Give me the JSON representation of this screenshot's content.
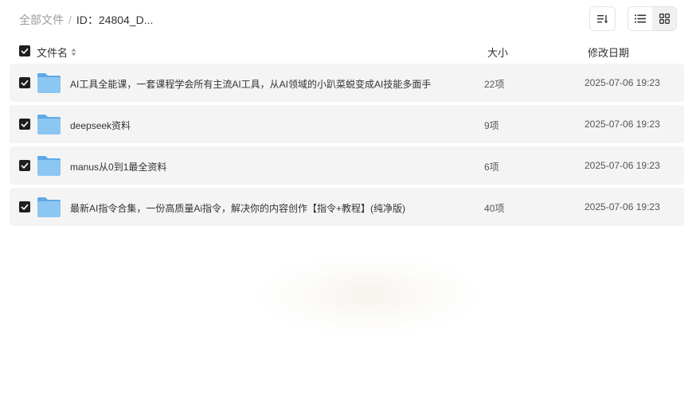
{
  "breadcrumb": {
    "root": "全部文件",
    "separator": "/",
    "current": "ID：24804_D..."
  },
  "toolbar": {
    "sort_icon": "sort-icon",
    "list_icon": "list-view-icon",
    "grid_icon": "grid-view-icon"
  },
  "table": {
    "columns": {
      "name": "文件名",
      "size": "大小",
      "date": "修改日期"
    },
    "rows": [
      {
        "icon": "folder-icon",
        "name": "AI工具全能课，一套课程学会所有主流AI工具，从AI领域的小趴菜蜕变成AI技能多面手",
        "size": "22项",
        "date": "2025-07-06 19:23",
        "checked": true
      },
      {
        "icon": "folder-icon",
        "name": "deepseek资料",
        "size": "9项",
        "date": "2025-07-06 19:23",
        "checked": true
      },
      {
        "icon": "folder-icon",
        "name": "manus从0到1最全资料",
        "size": "6项",
        "date": "2025-07-06 19:23",
        "checked": true
      },
      {
        "icon": "folder-icon",
        "name": "最新AI指令合集，一份高质量Ai指令，解决你的内容创作【指令+教程】(纯净版)",
        "size": "40项",
        "date": "2025-07-06 19:23",
        "checked": true
      }
    ]
  },
  "colors": {
    "checkbox": "#1f1f1f",
    "row_bg": "#f4f4f4",
    "folder": "#7fbef0"
  }
}
